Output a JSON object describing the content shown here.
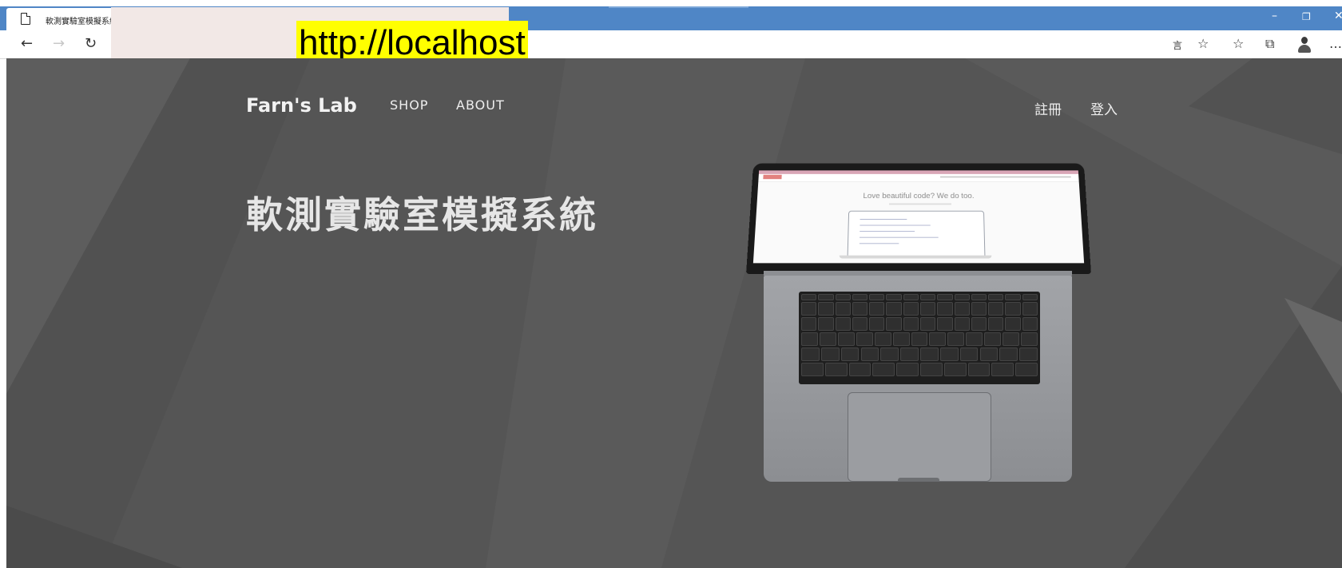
{
  "browser": {
    "tab_title": "軟測實驗室模擬系統",
    "url_overlay": "http://localhost",
    "window_controls": [
      "–",
      "❐",
      "✕"
    ],
    "nav_icons": [
      "back-icon",
      "forward-icon",
      "refresh-icon"
    ],
    "toolbar_icons": [
      "translate-icon",
      "favorite-star-icon",
      "favorites-list-icon",
      "collections-icon",
      "profile-avatar-icon",
      "more-icon"
    ]
  },
  "site": {
    "brand": "Farn's Lab",
    "nav": [
      "SHOP",
      "ABOUT"
    ],
    "auth": [
      "註冊",
      "登入"
    ],
    "hero_title": "軟測實驗室模擬系統",
    "screen_tagline": "Love beautiful code? We do too."
  }
}
